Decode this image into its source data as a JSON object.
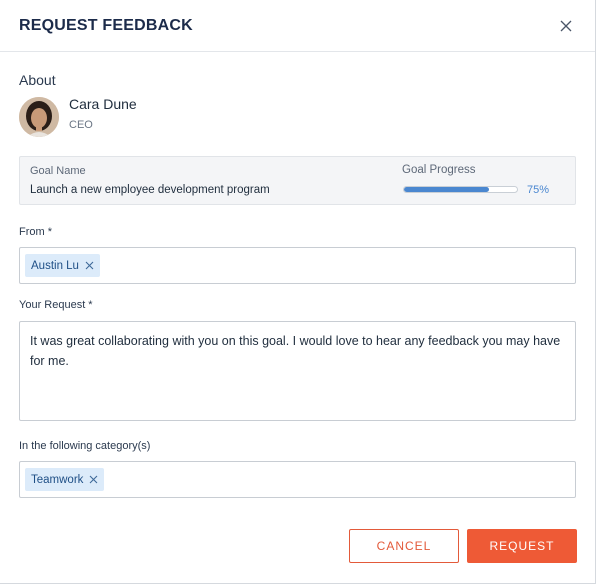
{
  "modal": {
    "title": "REQUEST FEEDBACK",
    "close_icon": "close-icon"
  },
  "about": {
    "label": "About",
    "person": {
      "name": "Cara Dune",
      "role": "CEO"
    }
  },
  "goal": {
    "name_label": "Goal Name",
    "name_value": "Launch a new employee development program",
    "progress_label": "Goal Progress",
    "progress_text": "75%",
    "progress_fraction": 0.75,
    "progress_color": "#4a87d0"
  },
  "from": {
    "label": "From *",
    "chips": [
      {
        "label": "Austin Lu"
      }
    ]
  },
  "request": {
    "label": "Your Request *",
    "value": "It was great collaborating with you on this goal. I would love to hear any feedback you may have for me."
  },
  "category": {
    "label": "In the following category(s)",
    "chips": [
      {
        "label": "Teamwork"
      }
    ]
  },
  "actions": {
    "cancel_label": "CANCEL",
    "request_label": "REQUEST",
    "accent_color": "#ee5a36"
  }
}
